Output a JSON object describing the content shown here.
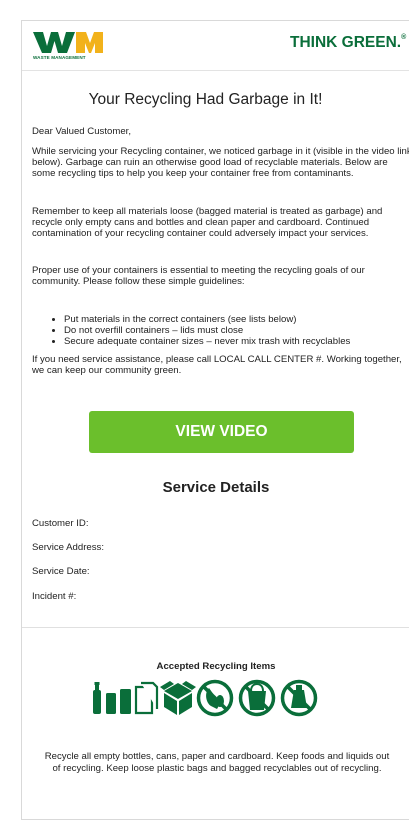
{
  "header": {
    "logo_letters": "WM",
    "logo_subtitle": "WASTE MANAGEMENT",
    "tagline": "THINK GREEN.",
    "tagline_mark": "®"
  },
  "email": {
    "title": "Your Recycling Had Garbage in It!",
    "greeting": "Dear Valued Customer,",
    "para1": "While servicing your Recycling container, we noticed garbage in it (visible in the video link below). Garbage can ruin an otherwise good load of recyclable materials. Below are some recycling tips to help you keep your container free from contaminants.",
    "para2": "Remember to keep all materials loose (bagged material is treated as garbage) and recycle only empty cans and bottles and clean paper and cardboard. Continued contamination of your recycling container could adversely impact your services.",
    "para3": "Proper use of your containers is essential to meeting the recycling goals of our community. Please follow these simple guidelines:",
    "guidelines": [
      "Put materials in the correct containers (see lists below)",
      "Do not overfill containers – lids must close",
      "Secure adequate container sizes – never mix trash with recyclables"
    ],
    "para4": "If you need service assistance, please call LOCAL CALL CENTER #. Working together, we can keep our community green.",
    "button_label": "VIEW VIDEO"
  },
  "service": {
    "title": "Service Details",
    "customer_id": "Customer ID:",
    "service_address": "Service Address:",
    "service_date": "Service Date:",
    "incident": "Incident #:"
  },
  "accepted": {
    "title": "Accepted Recycling Items",
    "icons": [
      "bottle-icon",
      "can-icon",
      "paper-icon",
      "cardboard-box-icon",
      "no-food-icon",
      "no-bags-icon",
      "no-liquids-icon"
    ],
    "icon_color": "#0a6e3a",
    "footer": "Recycle all empty bottles, cans, paper and cardboard. Keep foods and liquids out of recycling. Keep loose plastic bags and bagged recyclables out of recycling."
  }
}
